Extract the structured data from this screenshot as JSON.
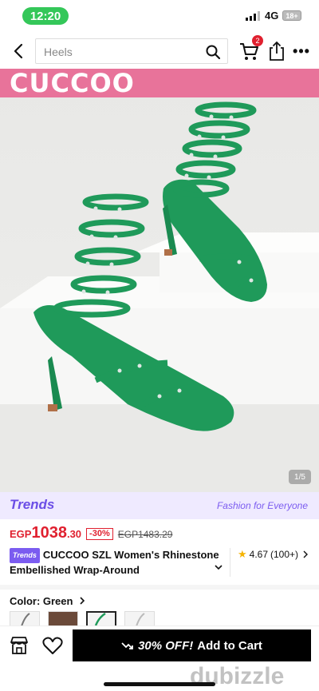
{
  "status_bar": {
    "time": "12:20",
    "network": "4G",
    "battery": "18+"
  },
  "header": {
    "search_placeholder": "Heels",
    "cart_count": "2"
  },
  "hero": {
    "brand": "CUCCOO",
    "image_counter": "1/5",
    "product_color": "#1f9a5a"
  },
  "trends": {
    "logo": "Trends",
    "tagline": "Fashion for Everyone"
  },
  "price": {
    "currency": "EGP",
    "amount": "1038",
    "decimals": ".30",
    "discount": "-30%",
    "original": "EGP1483.29"
  },
  "product": {
    "badge": "Trends",
    "title": "CUCCOO SZL Women's Rhinestone Embellished Wrap-Around",
    "rating": "4.67",
    "reviews": "(100+)"
  },
  "color": {
    "label": "Color: Green"
  },
  "bottom_bar": {
    "discount_text": "30% OFF!",
    "add_to_cart": "Add to Cart"
  },
  "watermark": "dubizzle",
  "colors": {
    "accent_red": "#e0202f",
    "trends_purple": "#7b5cf0",
    "brand_pink": "#e8739a"
  }
}
